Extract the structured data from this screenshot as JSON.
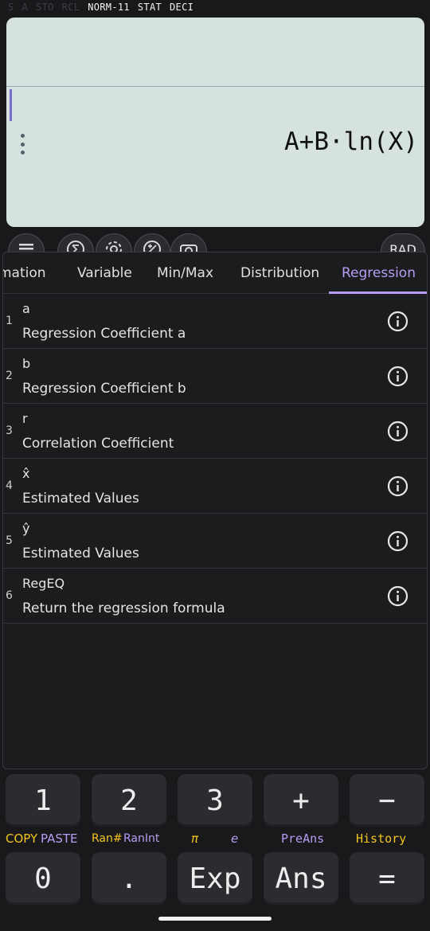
{
  "status_bar": {
    "dim_items": [
      "S",
      "A",
      "STO",
      "RCL"
    ],
    "mode": "NORM-11",
    "stat": "STAT",
    "deci": "DECI"
  },
  "display": {
    "expression": "A+B·ln(X)"
  },
  "toolbar": {
    "angle_mode": "RAD"
  },
  "tabs": [
    {
      "label": "mation",
      "active": false
    },
    {
      "label": "Variable",
      "active": false
    },
    {
      "label": "Min/Max",
      "active": false
    },
    {
      "label": "Distribution",
      "active": false
    },
    {
      "label": "Regression",
      "active": true
    }
  ],
  "rows": [
    {
      "num": "1",
      "name": "a",
      "desc": "Regression Coefficient a"
    },
    {
      "num": "2",
      "name": "b",
      "desc": "Regression Coefficient b"
    },
    {
      "num": "3",
      "name": "r",
      "desc": "Correlation Coefficient"
    },
    {
      "num": "4",
      "name": "x̂",
      "desc": "Estimated Values"
    },
    {
      "num": "5",
      "name": "ŷ",
      "desc": "Estimated Values"
    },
    {
      "num": "6",
      "name": "RegEQ",
      "desc": "Return the regression formula"
    }
  ],
  "keypad": {
    "row1": [
      "1",
      "2",
      "3",
      "+",
      "−"
    ],
    "sublabels": {
      "copy": "COPY",
      "paste": "PASTE",
      "ran_hash": "Ran#",
      "ranint": "RanInt",
      "pi": "π",
      "e": "e",
      "preans": "PreAns",
      "history": "History"
    },
    "row2": [
      "0",
      ".",
      "Exp",
      "Ans",
      "="
    ]
  },
  "colors": {
    "accent": "#b79cf4",
    "secondary": "#f2c421",
    "display_bg": "#d5e2e0"
  }
}
